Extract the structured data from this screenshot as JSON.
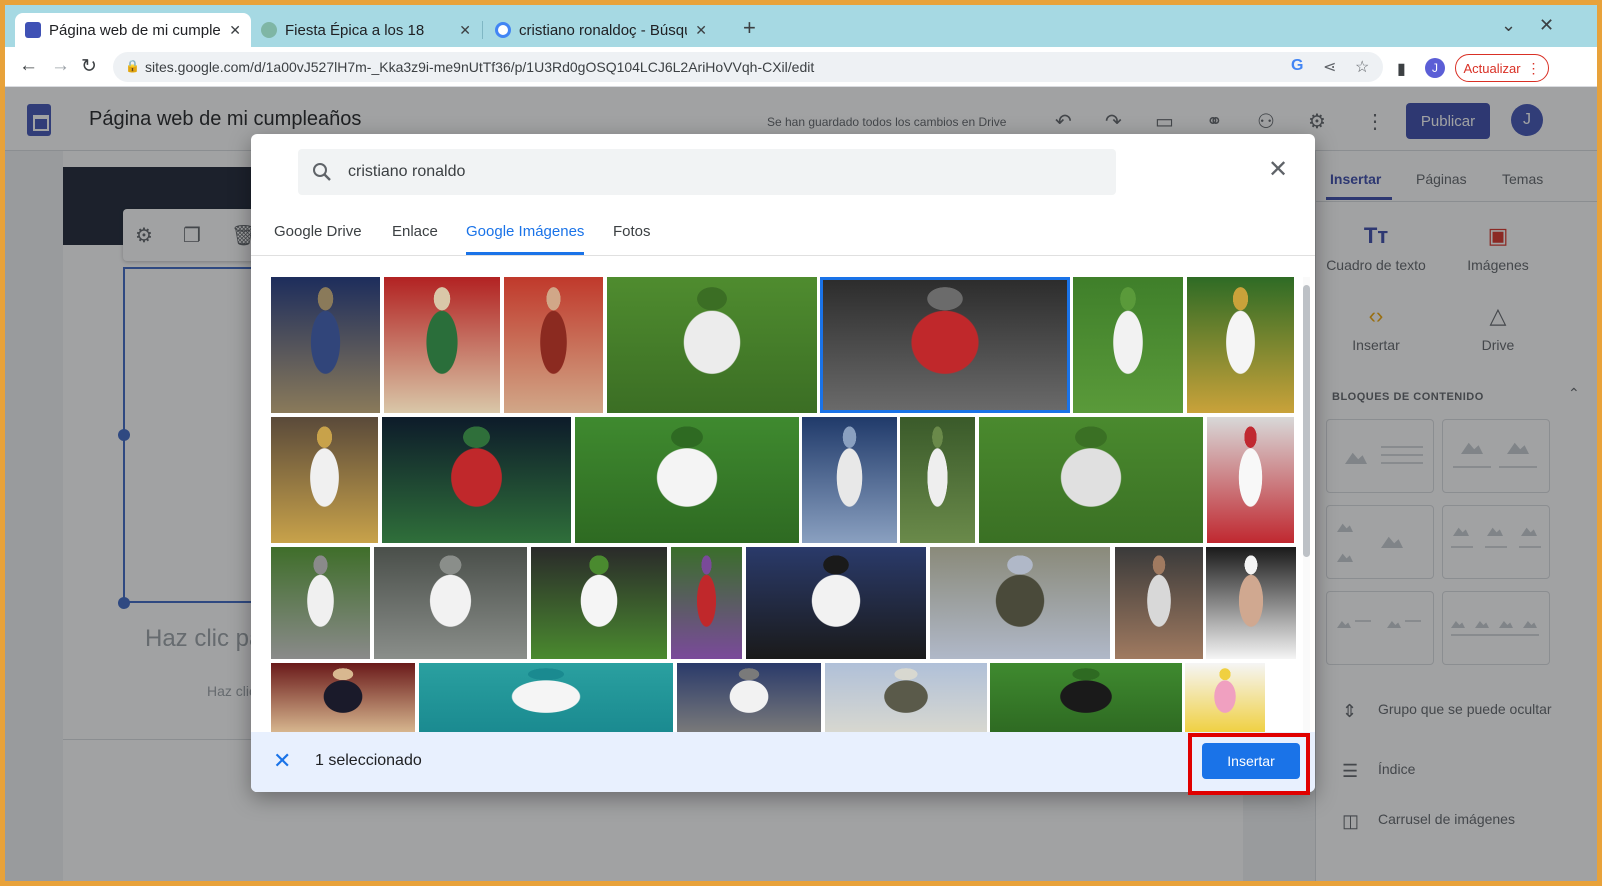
{
  "browser": {
    "tabs": [
      {
        "title": "Página web de mi cumpleaños",
        "favicon_color": "#3f51b5",
        "active": true
      },
      {
        "title": "Fiesta Épica a los 18",
        "favicon_color": "#7fb6a5",
        "active": false
      },
      {
        "title": "cristiano ronaldoç - Búsqueda de Google",
        "favicon_color": "#4285f4",
        "active": false
      }
    ],
    "new_tab_label": "+",
    "url": "sites.google.com/d/1a00vJ527lH7m-_Kka3z9i-me9nUtTf36/p/1U3Rd0gOSQ104LCJ6L2AriHoVVqh-CXil/edit",
    "profile_initial": "J",
    "update_label": "Actualizar"
  },
  "sites": {
    "title": "Página web de mi cumpleaños",
    "saved_status": "Se han guardado todos los cambios en Drive",
    "publish_label": "Publicar",
    "profile_initial": "J",
    "placeholder_title": "Haz clic pa",
    "placeholder_body": "Haz clic"
  },
  "right_panel": {
    "tabs": [
      "Insertar",
      "Páginas",
      "Temas"
    ],
    "insert_items": [
      "Cuadro de texto",
      "Imágenes",
      "Insertar",
      "Drive"
    ],
    "content_blocks_title": "BLOQUES DE CONTENIDO",
    "list_items": [
      "Grupo que se puede ocultar",
      "Índice",
      "Carrusel de imágenes"
    ]
  },
  "dialog": {
    "search_value": "cristiano ronaldo",
    "source_tabs": [
      "Google Drive",
      "Enlace",
      "Google Imágenes",
      "Fotos"
    ],
    "active_source_tab": "Google Imágenes",
    "selected_count_label": "1 seleccionado",
    "insert_label": "Insertar",
    "images": [
      {
        "desc": "player-blue-kit",
        "colors": [
          "#1d2d5c",
          "#31457a",
          "#8a7a5a"
        ]
      },
      {
        "desc": "player-portugal-red",
        "colors": [
          "#b22222",
          "#2a6e3a",
          "#d9c7a8"
        ]
      },
      {
        "desc": "portrait-red",
        "colors": [
          "#c0392b",
          "#8b2a20",
          "#d1a788"
        ]
      },
      {
        "desc": "player-sitting-grass",
        "colors": [
          "#4f8c2f",
          "#ececec",
          "#3b6e24"
        ]
      },
      {
        "desc": "celebration-red",
        "colors": [
          "#2b2b2b",
          "#c0282b",
          "#6b6b6b"
        ],
        "selected": true
      },
      {
        "desc": "player-white-field",
        "colors": [
          "#3f7f2a",
          "#f2f2f2",
          "#5a9a3a"
        ]
      },
      {
        "desc": "ballon-dor",
        "colors": [
          "#2e6b25",
          "#f5f5f5",
          "#c9a23a"
        ]
      },
      {
        "desc": "madrid-crowd",
        "colors": [
          "#5a4a3a",
          "#f0f0f0",
          "#c8a24a"
        ]
      },
      {
        "desc": "portugal-kick",
        "colors": [
          "#0d1b2a",
          "#c0282b",
          "#2f6f3a"
        ]
      },
      {
        "desc": "ronaldo-back-7",
        "colors": [
          "#3f8a2f",
          "#f4f4f4",
          "#2e6a22"
        ]
      },
      {
        "desc": "tunnel",
        "colors": [
          "#203a6a",
          "#e8e8e8",
          "#8aa0c0"
        ]
      },
      {
        "desc": "players-walking",
        "colors": [
          "#3a5a2a",
          "#eeeeee",
          "#6a8a4a"
        ]
      },
      {
        "desc": "tv-broadcast",
        "colors": [
          "#4a8a2e",
          "#e0e0e0",
          "#3a7024"
        ]
      },
      {
        "desc": "portugal-white",
        "colors": [
          "#d8d8d8",
          "#f8f8f8",
          "#c02830"
        ]
      },
      {
        "desc": "two-players-hug",
        "colors": [
          "#3f6e2a",
          "#f0f0f0",
          "#8a8a8a"
        ]
      },
      {
        "desc": "back-number-7",
        "colors": [
          "#4a4f4a",
          "#f2f2f2",
          "#8a8e8a"
        ]
      },
      {
        "desc": "celebration-white",
        "colors": [
          "#2a2a2a",
          "#f5f5f5",
          "#4a8a2f"
        ]
      },
      {
        "desc": "red-kit-running",
        "colors": [
          "#3a6e2a",
          "#c0282b",
          "#7a4a9a"
        ]
      },
      {
        "desc": "portugal-team",
        "colors": [
          "#2a3a6a",
          "#f2f2f2",
          "#1a1a1a"
        ]
      },
      {
        "desc": "statue-city",
        "colors": [
          "#8a8a7a",
          "#4a4a3a",
          "#b0b8c8"
        ]
      },
      {
        "desc": "man-beard",
        "colors": [
          "#3a3a3a",
          "#d8d8d8",
          "#a07a60"
        ]
      },
      {
        "desc": "actor-portrait",
        "colors": [
          "#1a1a1a",
          "#d0a890",
          "#f5f5f5"
        ]
      },
      {
        "desc": "two-men-formal",
        "colors": [
          "#6a1a1a",
          "#1a1a2a",
          "#d8b890"
        ]
      },
      {
        "desc": "yacht-sea",
        "colors": [
          "#2aa0a0",
          "#f5f5f5",
          "#1a8a90"
        ]
      },
      {
        "desc": "two-players-talking",
        "colors": [
          "#2a3a6a",
          "#f2f2f2",
          "#7a7a7a"
        ]
      },
      {
        "desc": "statue-harbor",
        "colors": [
          "#b0c0d8",
          "#5a5a4a",
          "#d8d8d0"
        ]
      },
      {
        "desc": "back-black-kit",
        "colors": [
          "#3f8a2f",
          "#1a1a1a",
          "#2e6a22"
        ]
      },
      {
        "desc": "watercolor-art",
        "colors": [
          "#f5f5f5",
          "#f0a0c0",
          "#f0d040"
        ]
      }
    ]
  }
}
